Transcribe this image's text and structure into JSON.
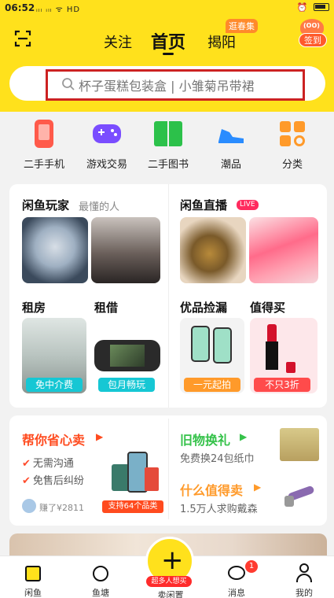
{
  "status_bar": {
    "time": "06:52",
    "signal_icons": "ᵢₗₗ ᵢₗₗ ᯤ HD",
    "battery_label": ""
  },
  "header": {
    "tabs": [
      {
        "label": "关注"
      },
      {
        "label": "首页"
      },
      {
        "label": "揭阳"
      }
    ],
    "badge": "逛春集",
    "checkin_label": "签到"
  },
  "search": {
    "placeholder": "杯子蛋糕包装盒 | 小雏菊吊带裙"
  },
  "categories": [
    {
      "label": "二手手机",
      "icon": "phone-icon",
      "color": "#ff5a4a"
    },
    {
      "label": "游戏交易",
      "icon": "gamepad-icon",
      "color": "#7a4dff"
    },
    {
      "label": "二手图书",
      "icon": "book-icon",
      "color": "#2cc14a"
    },
    {
      "label": "潮品",
      "icon": "sneaker-icon",
      "color": "#2a8cff"
    },
    {
      "label": "分类",
      "icon": "grid-icon",
      "color": "#ff9a2a"
    }
  ],
  "sections": {
    "player": {
      "title": "闲鱼玩家",
      "subtitle": "最懂的人"
    },
    "live": {
      "title": "闲鱼直播",
      "badge": "LIVE"
    },
    "rent": {
      "title": "租房",
      "tag": "免中介费"
    },
    "borrow": {
      "title": "租借",
      "tag": "包月畅玩"
    },
    "deals": {
      "title": "优品捡漏",
      "tag": "一元起拍"
    },
    "worth": {
      "title": "值得买",
      "tag": "不只3折"
    }
  },
  "sell": {
    "title": "帮你省心卖",
    "bullets": [
      "无需沟通",
      "免售后纠纷"
    ],
    "earned": "赚了¥2811",
    "tag": "支持64个品类"
  },
  "exchange": {
    "title": "旧物换礼",
    "subtitle": "免费换24包纸巾"
  },
  "worthbuy": {
    "title": "什么值得卖",
    "subtitle": "1.5万人求购戴森"
  },
  "bottom_nav": {
    "items": [
      {
        "label": "闲鱼"
      },
      {
        "label": "鱼塘"
      },
      {
        "label": "卖闲置"
      },
      {
        "label": "消息"
      },
      {
        "label": "我的"
      }
    ],
    "post_tag": "超多人想买",
    "message_count": "1"
  },
  "colors": {
    "brand_yellow": "#ffe11c",
    "accent_red": "#ff4b2b",
    "highlight_box": "#cc2222"
  }
}
